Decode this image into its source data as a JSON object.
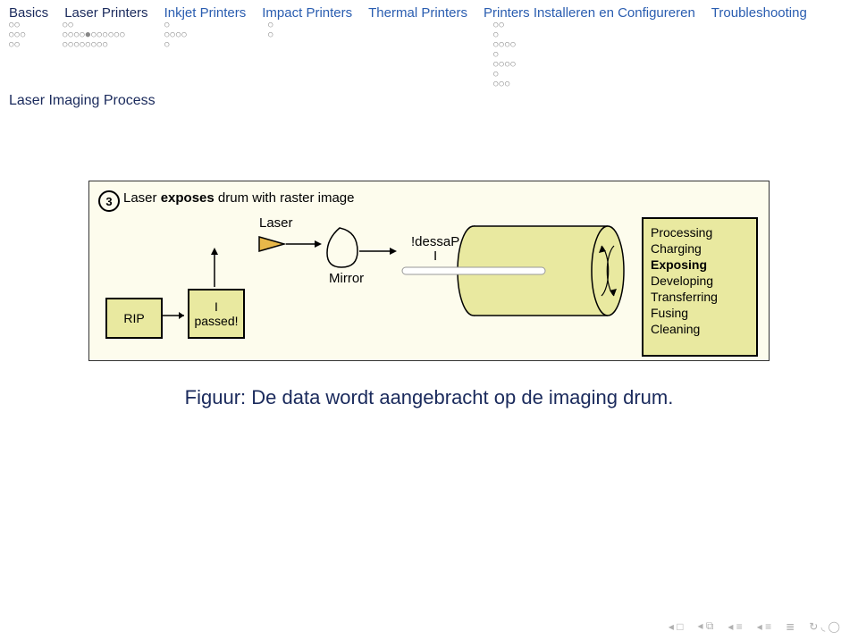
{
  "nav": {
    "items": [
      {
        "label": "Basics",
        "active": false,
        "link": false
      },
      {
        "label": "Laser Printers",
        "active": true,
        "link": false
      },
      {
        "label": "Inkjet Printers",
        "active": false,
        "link": true
      },
      {
        "label": "Impact Printers",
        "active": false,
        "link": true
      },
      {
        "label": "Thermal Printers",
        "active": false,
        "link": true
      },
      {
        "label": "Printers Installeren en Configureren",
        "active": false,
        "link": true
      },
      {
        "label": "Troubleshooting",
        "active": false,
        "link": true
      }
    ],
    "dots": [
      "○○\n○○○\n○○",
      "○○\n○○○○●○○○○○○\n○○○○○○○○",
      "○\n○○○○\n○",
      "○\n○\n",
      "",
      "○○\n○\n○○○○\n○\n○○○○\n○\n○○○",
      ""
    ]
  },
  "section_title": "Laser Imaging Process",
  "figure": {
    "step_num": "3",
    "step_title_plain": "Laser ",
    "step_title_bold": "exposes",
    "step_title_rest": " drum with raster image",
    "laser_label": "Laser",
    "mirror_label": "Mirror",
    "rip": "RIP",
    "passed_line1": "I",
    "passed_line2": "passed!",
    "dessa_line1": "!dessaP",
    "dessa_line2": "I",
    "stages": [
      "Processing",
      "Charging",
      "Exposing",
      "Developing",
      "Transferring",
      "Fusing",
      "Cleaning"
    ],
    "active_stage_index": 2
  },
  "caption": "Figuur: De data wordt aangebracht op de imaging drum.",
  "footer": {
    "icons": [
      "first",
      "prev-sec",
      "prev",
      "next",
      "last",
      "cycle"
    ]
  }
}
